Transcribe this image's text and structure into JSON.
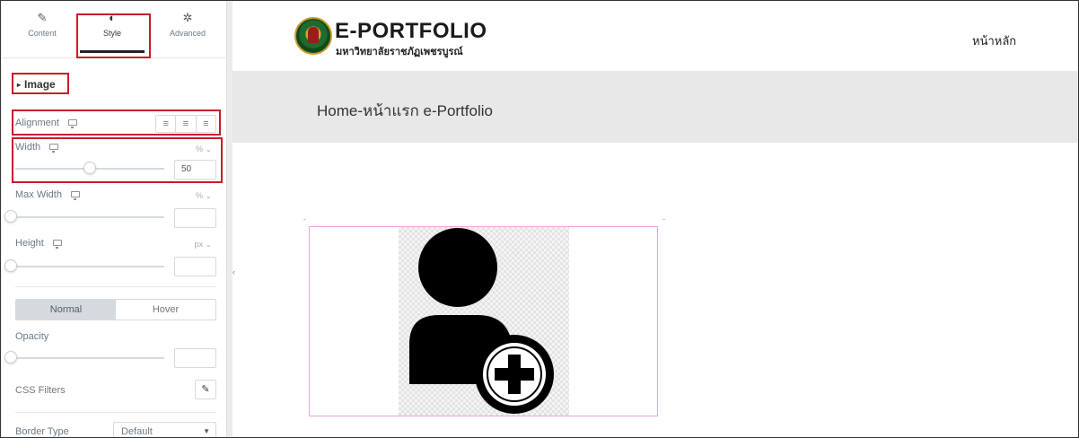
{
  "panel": {
    "tabs": [
      {
        "label": "Content",
        "icon": "pencil-icon"
      },
      {
        "label": "Style",
        "icon": "half-circle-icon"
      },
      {
        "label": "Advanced",
        "icon": "gear-icon"
      }
    ],
    "active_tab": "Style",
    "section_title": "Image",
    "controls": {
      "alignment_label": "Alignment",
      "width_label": "Width",
      "width_unit": "% ⌄",
      "width_value": "50",
      "width_slider_fraction": 0.5,
      "max_width_label": "Max Width",
      "max_width_unit": "% ⌄",
      "height_label": "Height",
      "height_unit": "px ⌄",
      "state_normal": "Normal",
      "state_hover": "Hover",
      "opacity_label": "Opacity",
      "css_filters_label": "CSS Filters",
      "border_type_label": "Border Type",
      "border_type_value": "Default"
    },
    "highlight_color": "#c41e2a"
  },
  "site": {
    "title": "E-PORTFOLIO",
    "subtitle": "มหาวิทยาลัยราชภัฏเพชรบูรณ์",
    "nav_home": "หน้าหลัก",
    "page_heading": "Home-หน้าแรก e-Portfolio",
    "image_icon": "add-user-icon"
  }
}
